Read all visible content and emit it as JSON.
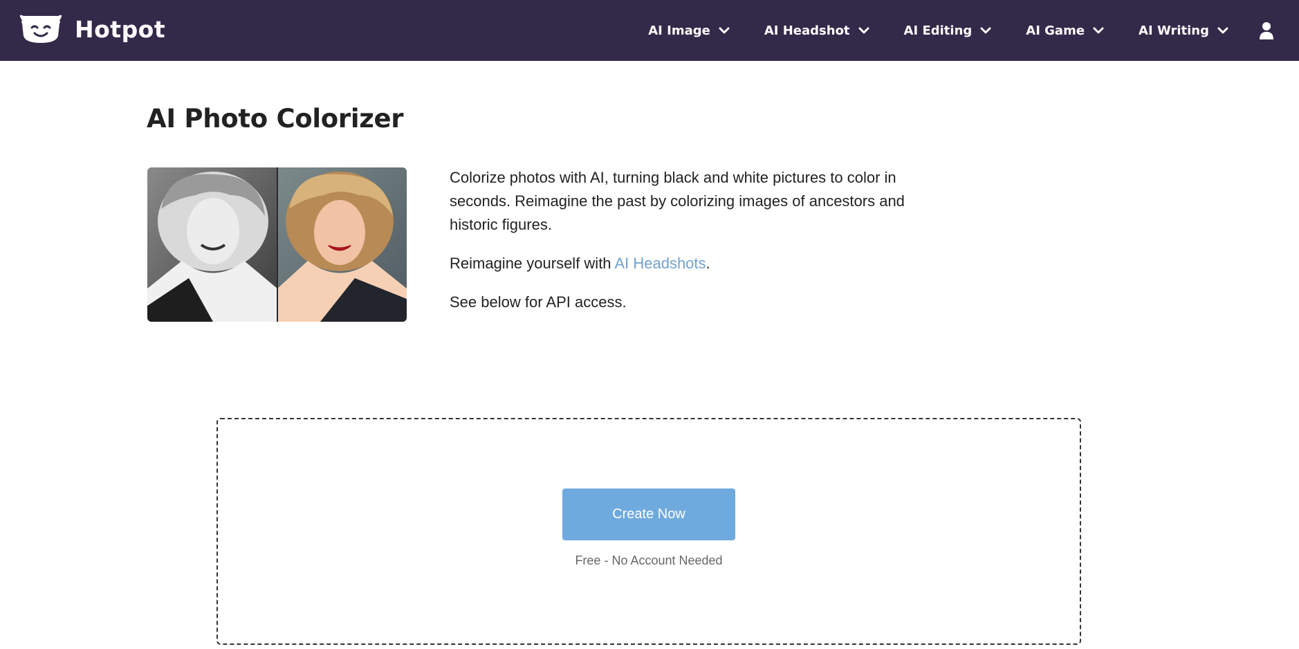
{
  "brand": {
    "name": "Hotpot",
    "logo_icon": "smiling-pot-logo-icon"
  },
  "nav": {
    "items": [
      {
        "label": "AI Image",
        "icon": "chevron-down-icon"
      },
      {
        "label": "AI Headshot",
        "icon": "chevron-down-icon"
      },
      {
        "label": "AI Editing",
        "icon": "chevron-down-icon"
      },
      {
        "label": "AI Game",
        "icon": "chevron-down-icon"
      },
      {
        "label": "AI Writing",
        "icon": "chevron-down-icon"
      }
    ],
    "user_icon": "user-icon"
  },
  "main": {
    "title": "AI Photo Colorizer",
    "intro_paragraph": "Colorize photos with AI, turning black and white pictures to color in seconds. Reimagine the past by colorizing images of ancestors and historic figures.",
    "headshot_prefix": "Reimagine yourself with ",
    "headshot_link": "AI Headshots",
    "headshot_suffix": ".",
    "api_note": "See below for API access."
  },
  "create": {
    "button_label": "Create Now",
    "note": "Free - No Account Needed"
  },
  "colors": {
    "nav_background": "#332a4a",
    "link": "#6fa1d2",
    "button": "#6faadf"
  }
}
